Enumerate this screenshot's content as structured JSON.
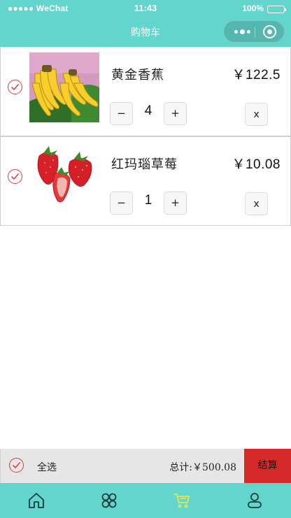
{
  "status_bar": {
    "carrier": "●●●●● WeChat",
    "time": "11:43",
    "battery": "100%"
  },
  "nav": {
    "title": "购物车",
    "more_icon": "more-dots-icon",
    "close_icon": "target-circle-icon"
  },
  "cart": {
    "items": [
      {
        "name": "黄金香蕉",
        "price": "￥122.5",
        "quantity": "4",
        "minus": "−",
        "plus": "+",
        "delete": "x",
        "checked": true,
        "image": "banana-image"
      },
      {
        "name": "红玛瑙草莓",
        "price": "￥10.08",
        "quantity": "1",
        "minus": "−",
        "plus": "+",
        "delete": "x",
        "checked": true,
        "image": "strawberry-image"
      }
    ]
  },
  "summary": {
    "select_all": "全选",
    "total": "总计:￥500.08",
    "checkout": "结算"
  },
  "tabbar": {
    "tabs": [
      {
        "icon": "home-icon",
        "active": false
      },
      {
        "icon": "category-icon",
        "active": false
      },
      {
        "icon": "cart-icon",
        "active": true
      },
      {
        "icon": "user-icon",
        "active": false
      }
    ]
  },
  "colors": {
    "theme": "#62d6cc",
    "check_red": "#d93b3b",
    "checkout_red": "#d62a2a",
    "active_tab": "#e8e64a",
    "inactive_tab": "#1f3b3a"
  }
}
